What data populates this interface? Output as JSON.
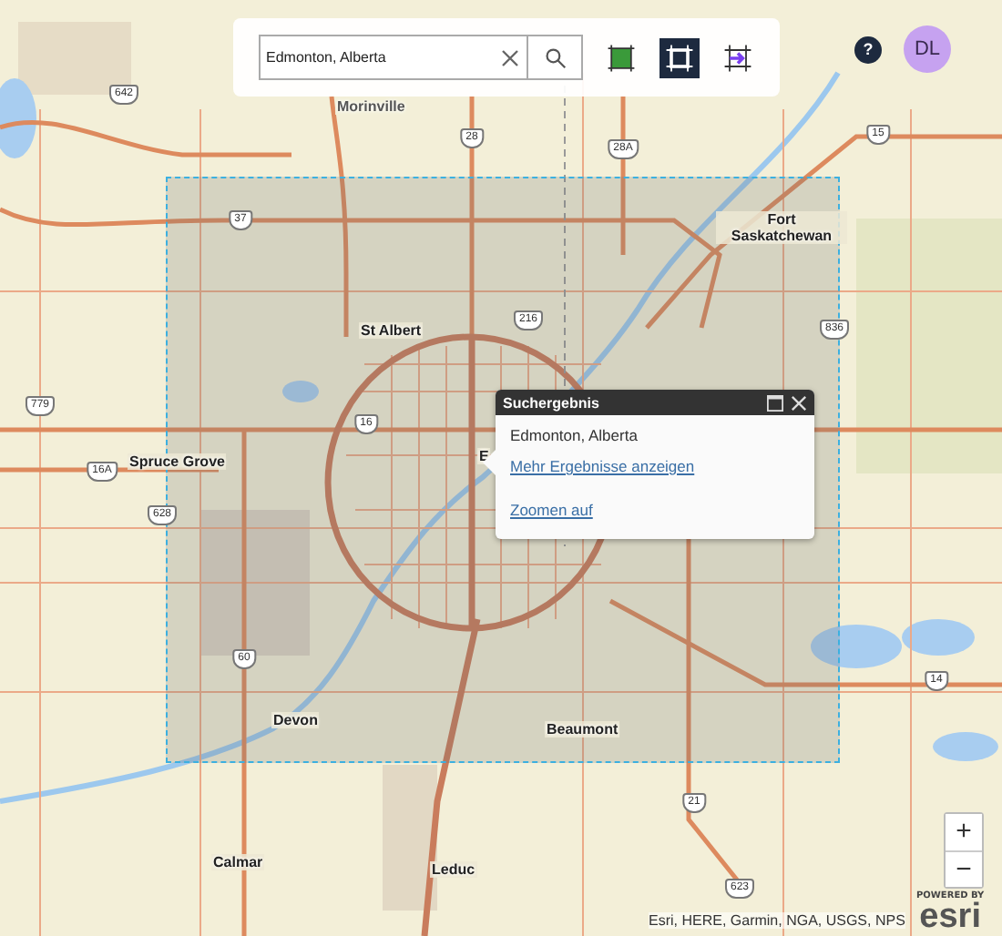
{
  "search": {
    "value": "Edmonton, Alberta"
  },
  "tools": [
    {
      "kind": "draw-rectangle",
      "selected": false
    },
    {
      "kind": "extent",
      "selected": true
    },
    {
      "kind": "move-extent",
      "selected": false
    }
  ],
  "help": {
    "label": "?"
  },
  "user": {
    "initials": "DL"
  },
  "map": {
    "places": [
      "Morinville",
      "St Albert",
      "Fort Saskatchewan",
      "Spruce Grove",
      "Devon",
      "Beaumont",
      "Calmar",
      "Leduc",
      "E"
    ],
    "shields": [
      "642",
      "28",
      "28A",
      "15",
      "37",
      "216",
      "836",
      "16",
      "16A",
      "779",
      "628",
      "60",
      "14",
      "21",
      "623"
    ]
  },
  "popup": {
    "title": "Suchergebnis",
    "result": "Edmonton, Alberta",
    "links": [
      "Mehr Ergebnisse anzeigen",
      "Zoomen auf"
    ]
  },
  "zoom": {
    "in": "+",
    "out": "−"
  },
  "attribution": "Esri, HERE, Garmin, NGA, USGS, NPS",
  "logo": {
    "caption": "POWERED BY",
    "name": "esri"
  }
}
